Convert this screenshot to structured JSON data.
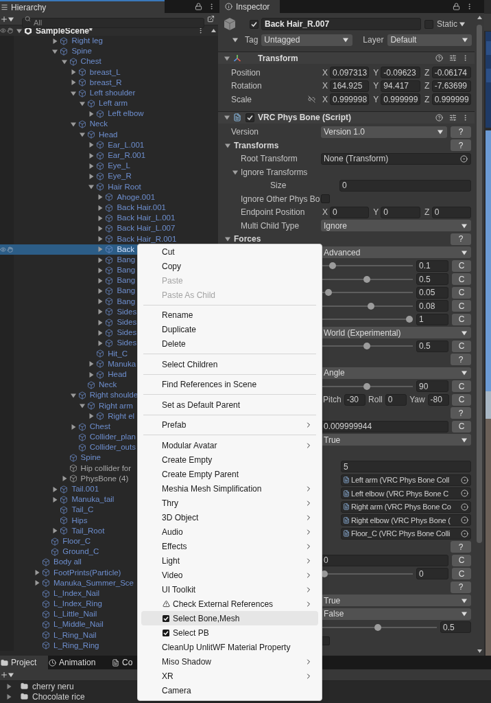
{
  "hierarchy": {
    "tab": "Hierarchy",
    "search": {
      "placeholder": "All"
    },
    "scene": {
      "name": "SampleScene*",
      "expanded": true
    },
    "tree": [
      {
        "kind": "scrolled_out",
        "children": [
          {
            "kind": "scrolled_out",
            "children": [
              {
                "label": "Right leg",
                "prefab": true,
                "expandable": true,
                "expanded": false,
                "selected": false
              },
              {
                "label": "Spine",
                "prefab": true,
                "expandable": true,
                "expanded": true,
                "selected": false,
                "children": [
                  {
                    "label": "Chest",
                    "prefab": true,
                    "expandable": true,
                    "expanded": true,
                    "selected": false,
                    "children": [
                      {
                        "label": "breast_L",
                        "prefab": true,
                        "expandable": true,
                        "expanded": false,
                        "selected": false
                      },
                      {
                        "label": "breast_R",
                        "prefab": true,
                        "expandable": true,
                        "expanded": false,
                        "selected": false
                      },
                      {
                        "label": "Left shoulder",
                        "prefab": true,
                        "expandable": true,
                        "expanded": true,
                        "selected": false,
                        "children": [
                          {
                            "label": "Left arm",
                            "prefab": true,
                            "expandable": true,
                            "expanded": true,
                            "selected": false,
                            "children": [
                              {
                                "label": "Left elbow",
                                "prefab": true,
                                "expandable": true,
                                "expanded": false,
                                "selected": false
                              }
                            ]
                          }
                        ]
                      },
                      {
                        "label": "Neck",
                        "prefab": true,
                        "expandable": true,
                        "expanded": true,
                        "selected": false,
                        "children": [
                          {
                            "label": "Head",
                            "prefab": true,
                            "expandable": true,
                            "expanded": true,
                            "selected": false,
                            "children": [
                              {
                                "label": "Ear_L.001",
                                "prefab": true,
                                "expandable": true,
                                "expanded": false,
                                "selected": false
                              },
                              {
                                "label": "Ear_R.001",
                                "prefab": true,
                                "expandable": true,
                                "expanded": false,
                                "selected": false
                              },
                              {
                                "label": "Eye_L",
                                "prefab": true,
                                "expandable": true,
                                "expanded": false,
                                "selected": false
                              },
                              {
                                "label": "Eye_R",
                                "prefab": true,
                                "expandable": true,
                                "expanded": false,
                                "selected": false
                              },
                              {
                                "label": "Hair Root",
                                "prefab": true,
                                "expandable": true,
                                "expanded": true,
                                "selected": false,
                                "children": [
                                  {
                                    "label": "Ahoge.001",
                                    "prefab": true,
                                    "expandable": true,
                                    "expanded": false,
                                    "selected": false
                                  },
                                  {
                                    "label": "Back Hair.001",
                                    "prefab": true,
                                    "expandable": true,
                                    "expanded": false,
                                    "selected": false
                                  },
                                  {
                                    "label": "Back Hair_L.001",
                                    "prefab": true,
                                    "expandable": true,
                                    "expanded": false,
                                    "selected": false
                                  },
                                  {
                                    "label": "Back Hair_L.007",
                                    "prefab": true,
                                    "expandable": true,
                                    "expanded": false,
                                    "selected": false
                                  },
                                  {
                                    "label": "Back Hair_R.001",
                                    "prefab": true,
                                    "expandable": true,
                                    "expanded": false,
                                    "selected": false
                                  },
                                  {
                                    "label": "Back",
                                    "prefab": true,
                                    "expandable": true,
                                    "expanded": false,
                                    "selected": true
                                  },
                                  {
                                    "label": "Bang",
                                    "prefab": true,
                                    "expandable": true,
                                    "expanded": false,
                                    "selected": false
                                  },
                                  {
                                    "label": "Bang",
                                    "prefab": true,
                                    "expandable": true,
                                    "expanded": false,
                                    "selected": false
                                  },
                                  {
                                    "label": "Bang",
                                    "prefab": true,
                                    "expandable": true,
                                    "expanded": false,
                                    "selected": false
                                  },
                                  {
                                    "label": "Bang",
                                    "prefab": true,
                                    "expandable": true,
                                    "expanded": false,
                                    "selected": false
                                  },
                                  {
                                    "label": "Bang",
                                    "prefab": true,
                                    "expandable": true,
                                    "expanded": false,
                                    "selected": false
                                  },
                                  {
                                    "label": "Sides",
                                    "prefab": true,
                                    "expandable": true,
                                    "expanded": false,
                                    "selected": false
                                  },
                                  {
                                    "label": "Sides",
                                    "prefab": true,
                                    "expandable": true,
                                    "expanded": false,
                                    "selected": false
                                  },
                                  {
                                    "label": "Sides",
                                    "prefab": true,
                                    "expandable": true,
                                    "expanded": false,
                                    "selected": false
                                  },
                                  {
                                    "label": "Sides",
                                    "prefab": true,
                                    "expandable": true,
                                    "expanded": false,
                                    "selected": false
                                  }
                                ]
                              },
                              {
                                "label": "Hit_C",
                                "prefab": true,
                                "expandable": false,
                                "selected": false
                              },
                              {
                                "label": "Manuka",
                                "prefab": true,
                                "expandable": true,
                                "expanded": false,
                                "selected": false
                              },
                              {
                                "label": "Head",
                                "prefab": true,
                                "expandable": true,
                                "expanded": false,
                                "selected": false
                              }
                            ]
                          },
                          {
                            "label": "Neck",
                            "prefab": true,
                            "expandable": false,
                            "selected": false
                          }
                        ]
                      },
                      {
                        "label": "Right shoulde",
                        "prefab": true,
                        "expandable": true,
                        "expanded": true,
                        "selected": false,
                        "children": [
                          {
                            "label": "Right arm",
                            "prefab": true,
                            "expandable": true,
                            "expanded": true,
                            "selected": false,
                            "children": [
                              {
                                "label": "Right el",
                                "prefab": true,
                                "expandable": true,
                                "expanded": false,
                                "selected": false
                              }
                            ]
                          }
                        ]
                      },
                      {
                        "label": "Chest",
                        "prefab": true,
                        "expandable": true,
                        "expanded": false,
                        "selected": false
                      },
                      {
                        "label": "Collider_plan",
                        "prefab": true,
                        "expandable": false,
                        "selected": false
                      },
                      {
                        "label": "Collider_outs",
                        "prefab": true,
                        "expandable": false,
                        "selected": false
                      }
                    ]
                  },
                  {
                    "label": "Spine",
                    "prefab": true,
                    "expandable": false,
                    "selected": false
                  },
                  {
                    "label": "Hip collider for",
                    "prefab": false,
                    "expandable": false,
                    "selected": false
                  },
                  {
                    "label": "PhysBone (4)",
                    "prefab": false,
                    "expandable": true,
                    "expanded": false,
                    "selected": false
                  }
                ]
              },
              {
                "label": "Tail.001",
                "prefab": true,
                "expandable": true,
                "expanded": false,
                "selected": false
              },
              {
                "label": "Manuka_tail",
                "prefab": true,
                "expandable": true,
                "expanded": false,
                "selected": false
              },
              {
                "label": "Tail_C",
                "prefab": true,
                "expandable": false,
                "selected": false
              },
              {
                "label": "Hips",
                "prefab": true,
                "expandable": false,
                "selected": false
              },
              {
                "label": "Tail_Root",
                "prefab": true,
                "expandable": true,
                "expanded": false,
                "selected": false
              }
            ]
          },
          {
            "label": "Floor_C",
            "prefab": true,
            "expandable": false,
            "selected": false
          },
          {
            "label": "Ground_C",
            "prefab": true,
            "expandable": false,
            "selected": false
          }
        ]
      },
      {
        "label": "Body all",
        "prefab": true,
        "expandable": false,
        "selected": false
      },
      {
        "label": "FootPrints(Particle)",
        "prefab": true,
        "expandable": true,
        "expanded": false,
        "selected": false
      },
      {
        "label": "Manuka_Summer_Sce",
        "prefab": true,
        "expandable": true,
        "expanded": false,
        "selected": false
      },
      {
        "label": "L_Index_Nail",
        "prefab": true,
        "expandable": false,
        "selected": false
      },
      {
        "label": "L_Index_Ring",
        "prefab": true,
        "expandable": false,
        "selected": false
      },
      {
        "label": "L_Little_Nail",
        "prefab": true,
        "expandable": false,
        "selected": false
      },
      {
        "label": "L_Middle_Nail",
        "prefab": true,
        "expandable": false,
        "selected": false
      },
      {
        "label": "L_Ring_Nail",
        "prefab": true,
        "expandable": false,
        "selected": false
      },
      {
        "label": "L_Ring_Ring",
        "prefab": true,
        "expandable": false,
        "selected": false
      }
    ]
  },
  "inspector": {
    "tab": "Inspector",
    "object": {
      "active": true,
      "name": "Back Hair_R.007",
      "static": false,
      "static_label": "Static",
      "tag_label": "Tag",
      "tag": "Untagged",
      "layer_label": "Layer",
      "layer": "Default"
    },
    "components": [
      {
        "kind": "transform",
        "title": "Transform",
        "expanded": true,
        "rows": [
          {
            "kind": "vector",
            "label": "Position",
            "link": false,
            "values": [
              {
                "axis": "X",
                "value": "0.097313"
              },
              {
                "axis": "Y",
                "value": "-0.09623"
              },
              {
                "axis": "Z",
                "value": "-0.06174"
              }
            ]
          },
          {
            "kind": "vector",
            "label": "Rotation",
            "link": false,
            "values": [
              {
                "axis": "X",
                "value": "164.925"
              },
              {
                "axis": "Y",
                "value": "94.417"
              },
              {
                "axis": "Z",
                "value": "-7.63699"
              }
            ]
          },
          {
            "kind": "vector",
            "label": "Scale",
            "link": true,
            "values": [
              {
                "axis": "X",
                "value": "0.999998"
              },
              {
                "axis": "Y",
                "value": "0.999999"
              },
              {
                "axis": "Z",
                "value": "0.999999"
              }
            ]
          }
        ]
      },
      {
        "kind": "script",
        "title": "VRC Phys Bone (Script)",
        "enabled": true,
        "expanded": true,
        "rows": [
          {
            "kind": "dropdown",
            "label": "Version",
            "value": "Version 1.0",
            "help": "?"
          },
          {
            "kind": "section",
            "label": "Transforms",
            "expanded": true,
            "help": "?",
            "children": [
              {
                "kind": "object",
                "label": "Root Transform",
                "value": "None (Transform)"
              },
              {
                "kind": "foldout",
                "label": "Ignore Transforms",
                "expanded": true,
                "children": [
                  {
                    "kind": "text",
                    "label": "Size",
                    "value": "0"
                  }
                ]
              },
              {
                "kind": "checkbox",
                "label": "Ignore Other Phys Bo",
                "checked": false
              },
              {
                "kind": "vector",
                "label": "Endpoint Position",
                "values": [
                  {
                    "axis": "X",
                    "value": "0"
                  },
                  {
                    "axis": "Y",
                    "value": "0"
                  },
                  {
                    "axis": "Z",
                    "value": "0"
                  }
                ]
              },
              {
                "kind": "dropdown",
                "label": "Multi Child Type",
                "value": "Ignore"
              }
            ]
          },
          {
            "kind": "section",
            "label": "Forces",
            "expanded": true,
            "help": "?",
            "children": [
              {
                "kind": "dropdown",
                "value": "Advanced"
              },
              {
                "kind": "slider",
                "level": 0.1,
                "value": "0.1",
                "reset": "C"
              },
              {
                "kind": "slider",
                "level": 0.5,
                "value": "0.5",
                "reset": "C"
              },
              {
                "kind": "slider",
                "level": 0.05,
                "value": "0.05",
                "reset": "C"
              },
              {
                "kind": "slider",
                "level": 0.55,
                "value": "0.08",
                "reset": "C"
              },
              {
                "kind": "slider",
                "level": 1,
                "value": "1",
                "reset": "C"
              },
              {
                "kind": "dropdown",
                "value": "World (Experimental)"
              },
              {
                "kind": "slider",
                "level": 0.5,
                "value": "0.5",
                "reset": "C"
              }
            ]
          },
          {
            "kind": "section",
            "help": "?",
            "children": [
              {
                "kind": "dropdown",
                "value": "Angle"
              },
              {
                "kind": "slider",
                "level": 0.5,
                "value": "90",
                "reset": "C"
              },
              {
                "kind": "angles",
                "items": [
                  {
                    "label": "Pitch",
                    "value": "-30"
                  },
                  {
                    "label": "Roll",
                    "value": "0"
                  },
                  {
                    "label": "Yaw",
                    "value": "-80"
                  }
                ],
                "reset": "C"
              }
            ]
          },
          {
            "kind": "section",
            "help": "?",
            "children": [
              {
                "kind": "text",
                "value": "0.009999944",
                "reset": "C"
              },
              {
                "kind": "dropdown",
                "value": "True"
              },
              {
                "kind": "list",
                "size": "5",
                "items": [
                  "Left arm (VRC Phys Bone Coll",
                  "Left elbow (VRC Phys Bone C",
                  "Right arm (VRC Phys Bone Co",
                  "Right elbow (VRC Phys Bone (",
                  "Floor_C (VRC Phys Bone Colli"
                ]
              }
            ]
          },
          {
            "kind": "section",
            "help": "?",
            "children": [
              {
                "kind": "text",
                "value": "0",
                "reset": "C"
              },
              {
                "kind": "slider",
                "level": 0,
                "value": "0",
                "reset": "C"
              }
            ]
          },
          {
            "kind": "section",
            "help": "?",
            "children": [
              {
                "kind": "dropdown",
                "value": "True"
              },
              {
                "kind": "dropdown",
                "value": "False"
              },
              {
                "kind": "slider",
                "level": 0.49,
                "value": "0.5"
              },
              {
                "kind": "checkbox",
                "checked": false
              }
            ]
          }
        ]
      }
    ]
  },
  "context_menu": {
    "groups": [
      [
        {
          "label": "Cut",
          "kind": "plain",
          "disabled": false,
          "submenu": false,
          "hovered": false
        },
        {
          "label": "Copy",
          "kind": "plain",
          "disabled": false,
          "submenu": false,
          "hovered": false
        },
        {
          "label": "Paste",
          "kind": "plain",
          "disabled": true,
          "submenu": false,
          "hovered": false
        },
        {
          "label": "Paste As Child",
          "kind": "plain",
          "disabled": true,
          "submenu": false,
          "hovered": false
        }
      ],
      [
        {
          "label": "Rename",
          "kind": "plain",
          "disabled": false,
          "submenu": false,
          "hovered": false
        },
        {
          "label": "Duplicate",
          "kind": "plain",
          "disabled": false,
          "submenu": false,
          "hovered": false
        },
        {
          "label": "Delete",
          "kind": "plain",
          "disabled": false,
          "submenu": false,
          "hovered": false
        }
      ],
      [
        {
          "label": "Select Children",
          "kind": "plain",
          "disabled": false,
          "submenu": false,
          "hovered": false
        }
      ],
      [
        {
          "label": "Find References in Scene",
          "kind": "plain",
          "disabled": false,
          "submenu": false,
          "hovered": false
        }
      ],
      [
        {
          "label": "Set as Default Parent",
          "kind": "plain",
          "disabled": false,
          "submenu": false,
          "hovered": false
        }
      ],
      [
        {
          "label": "Prefab",
          "kind": "plain",
          "disabled": false,
          "submenu": true,
          "hovered": false
        }
      ],
      [
        {
          "label": "Modular Avatar",
          "kind": "plain",
          "disabled": false,
          "submenu": true,
          "hovered": false
        },
        {
          "label": "Create Empty",
          "kind": "plain",
          "disabled": false,
          "submenu": false,
          "hovered": false
        },
        {
          "label": "Create Empty Parent",
          "kind": "plain",
          "disabled": false,
          "submenu": false,
          "hovered": false
        },
        {
          "label": "Meshia Mesh Simplification",
          "kind": "plain",
          "disabled": false,
          "submenu": true,
          "hovered": false
        },
        {
          "label": "Thry",
          "kind": "plain",
          "disabled": false,
          "submenu": true,
          "hovered": false
        },
        {
          "label": "3D Object",
          "kind": "plain",
          "disabled": false,
          "submenu": true,
          "hovered": false
        },
        {
          "label": "Audio",
          "kind": "plain",
          "disabled": false,
          "submenu": true,
          "hovered": false
        },
        {
          "label": "Effects",
          "kind": "plain",
          "disabled": false,
          "submenu": true,
          "hovered": false
        },
        {
          "label": "Light",
          "kind": "plain",
          "disabled": false,
          "submenu": true,
          "hovered": false
        },
        {
          "label": "Video",
          "kind": "plain",
          "disabled": false,
          "submenu": true,
          "hovered": false
        },
        {
          "label": "UI Toolkit",
          "kind": "plain",
          "disabled": false,
          "submenu": true,
          "hovered": false
        },
        {
          "label": "Check External References",
          "kind": "warning",
          "disabled": false,
          "submenu": true,
          "hovered": false
        },
        {
          "label": "Select Bone,Mesh",
          "kind": "checkbox",
          "checked": true,
          "disabled": false,
          "submenu": false,
          "hovered": true
        },
        {
          "label": "Select PB",
          "kind": "checkbox",
          "checked": true,
          "disabled": false,
          "submenu": false,
          "hovered": false
        },
        {
          "label": "CleanUp UnlitWF Material Property",
          "kind": "plain",
          "disabled": false,
          "submenu": false,
          "hovered": false
        },
        {
          "label": "Miso Shadow",
          "kind": "plain",
          "disabled": false,
          "submenu": true,
          "hovered": false
        },
        {
          "label": "XR",
          "kind": "plain",
          "disabled": false,
          "submenu": true,
          "hovered": false
        },
        {
          "label": "Camera",
          "kind": "plain",
          "disabled": false,
          "submenu": false,
          "hovered": false
        }
      ]
    ]
  },
  "bottom_panel": {
    "tabs": [
      {
        "label": "Project",
        "selected": true
      },
      {
        "label": "Animation",
        "selected": false
      },
      {
        "label": "Co",
        "selected": false
      }
    ],
    "folders": [
      {
        "label": "cherry neru",
        "expanded": false
      },
      {
        "label": "Chocolate rice",
        "expanded": false
      }
    ]
  }
}
